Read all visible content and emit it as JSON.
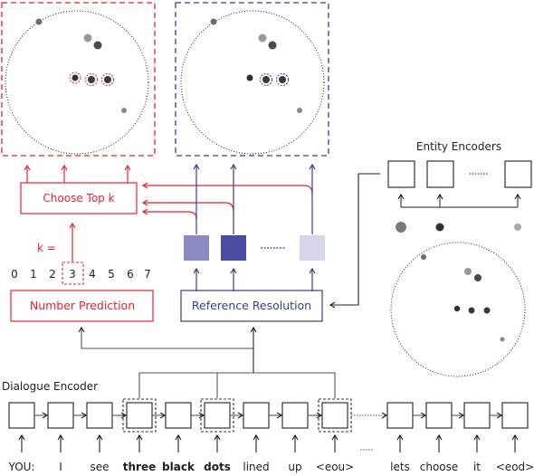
{
  "colors": {
    "red": "#e8222e",
    "blue": "#3b3c8f",
    "dark": "#231f20",
    "gray_line": "#555555"
  },
  "panels": {
    "left_panel_desc": "Selected entities view (red dashed frame)",
    "right_panel_desc": "Reference resolution view (blue dashed frame)"
  },
  "choose_top_k": {
    "label": "Choose Top k"
  },
  "k_label": "k =",
  "number_options": [
    "0",
    "1",
    "2",
    "3",
    "4",
    "5",
    "6",
    "7"
  ],
  "selected_number": "3",
  "number_prediction": {
    "label": "Number Prediction"
  },
  "reference_resolution": {
    "label": "Reference Resolution"
  },
  "reference_scores": [
    {
      "color": "#8b8bc2"
    },
    {
      "color": "#4a4aa0"
    },
    {
      "color": "#d6d6ea"
    }
  ],
  "entity_encoders": {
    "title": "Entity Encoders"
  },
  "entity_dots": [
    {
      "color": "#7a7a7a"
    },
    {
      "color": "#303030"
    },
    {
      "color": "#a8a8a8"
    }
  ],
  "dialogue_encoder": {
    "title": "Dialogue Encoder",
    "tokens": [
      {
        "text": "YOU:",
        "bold": false,
        "highlighted": false
      },
      {
        "text": "I",
        "bold": false,
        "highlighted": false
      },
      {
        "text": "see",
        "bold": false,
        "highlighted": false
      },
      {
        "text": "three",
        "bold": true,
        "highlighted": true
      },
      {
        "text": "black",
        "bold": true,
        "highlighted": false
      },
      {
        "text": "dots",
        "bold": true,
        "highlighted": true
      },
      {
        "text": "lined",
        "bold": false,
        "highlighted": false
      },
      {
        "text": "up",
        "bold": false,
        "highlighted": false
      },
      {
        "text": "<eou>",
        "bold": false,
        "highlighted": true
      },
      {
        "text": "lets",
        "bold": false,
        "highlighted": false
      },
      {
        "text": "choose",
        "bold": false,
        "highlighted": false
      },
      {
        "text": "it",
        "bold": false,
        "highlighted": false
      },
      {
        "text": "<eod>",
        "bold": false,
        "highlighted": false
      }
    ]
  }
}
